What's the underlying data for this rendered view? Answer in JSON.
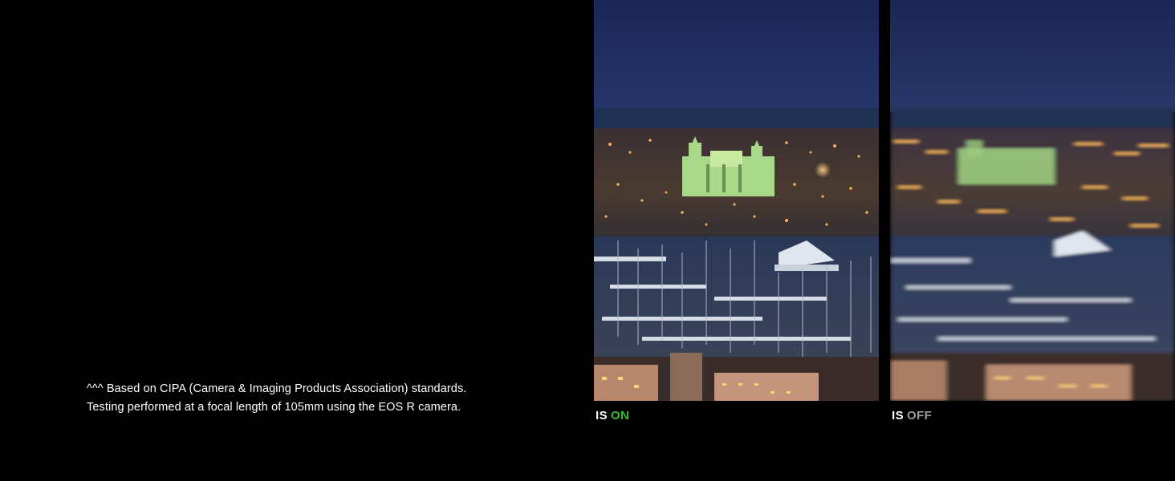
{
  "footnote": {
    "line1": "^^^ Based on CIPA (Camera & Imaging Products Association) standards.",
    "line2": "Testing performed at a focal length of 105mm using the EOS R camera."
  },
  "comparison": {
    "on": {
      "prefix": "IS",
      "state": "ON",
      "state_color": "#2fbf2f"
    },
    "off": {
      "prefix": "IS",
      "state": "OFF",
      "state_color": "#9a9a9a"
    }
  },
  "colors": {
    "sky": "#1e2d5e",
    "sea": "#1f3356",
    "lights": "#f2b25a",
    "cathedral": "#9fd17a"
  }
}
